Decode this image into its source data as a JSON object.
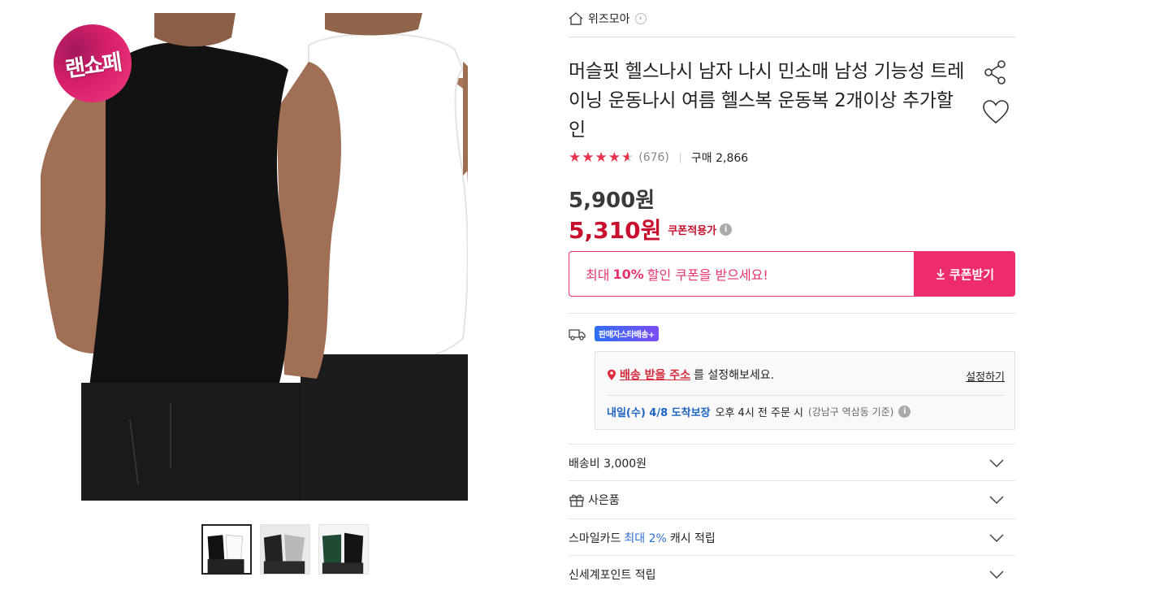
{
  "badge": {
    "text": "랜쇼페"
  },
  "store": {
    "name": "위즈모아"
  },
  "product": {
    "title": "머슬핏 헬스나시 남자 나시 민소매 남성 기능성 트레이닝 운동나시 여름 헬스복 운동복 2개이상 추가할인",
    "rating": 4.5,
    "review_count": "(676)",
    "purchase_label": "구매 2,866",
    "price_original": "5,900원",
    "price_sale": "5,310원",
    "coupon_applied_label": "쿠폰적용가"
  },
  "coupon": {
    "prefix": "최대",
    "percent": "10%",
    "suffix": "할인 쿠폰을 받으세요!",
    "button_label": "쿠폰받기"
  },
  "delivery": {
    "badge": "판매자스타배송+",
    "address_link": "배송 받을 주소",
    "address_suffix": "를 설정해보세요.",
    "set_label": "설정하기",
    "eta_date": "내일(수) 4/8 도착보장",
    "eta_cutoff": "오후 4시 전 주문 시",
    "eta_area": "(강남구 역삼동 기준)"
  },
  "accordion": {
    "shipping_fee": "배송비 3,000원",
    "gift": "사은품",
    "smilecard_prefix": "스마일카드",
    "smilecard_highlight": "최대 2%",
    "smilecard_suffix": "캐시 적립",
    "shinsegae": "신세계포인트 적립"
  },
  "colors": {
    "accent_pink": "#ee2b6c",
    "sale_red": "#c8102e",
    "star_red": "#e8344e",
    "eta_blue": "#1d64c5"
  },
  "icons": [
    "home-icon",
    "chevron-right-icon",
    "share-icon",
    "heart-icon",
    "star-icon",
    "info-icon",
    "download-icon",
    "truck-icon",
    "location-pin-icon",
    "gift-icon",
    "chevron-down-icon"
  ]
}
